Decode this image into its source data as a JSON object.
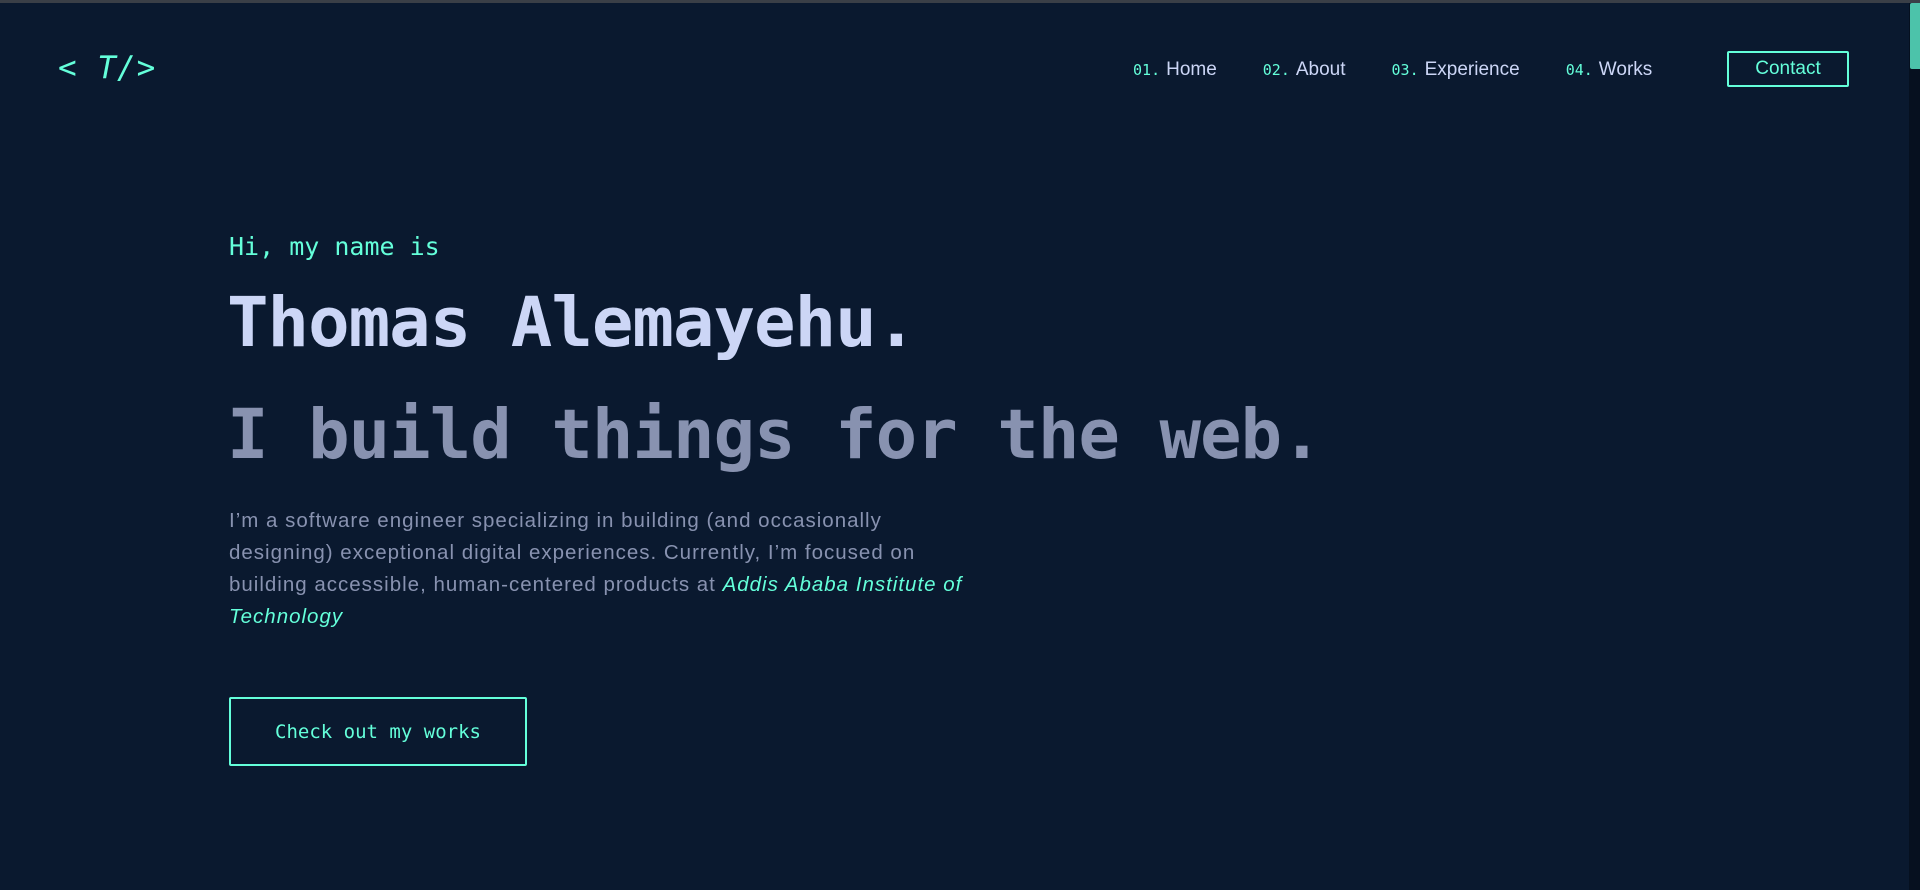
{
  "logo": {
    "text": "< T/>"
  },
  "nav": {
    "items": [
      {
        "num": "01",
        "label": "Home"
      },
      {
        "num": "02",
        "label": "About"
      },
      {
        "num": "03",
        "label": "Experience"
      },
      {
        "num": "04",
        "label": "Works"
      }
    ],
    "contact_label": "Contact"
  },
  "hero": {
    "greeting": "Hi, my name is",
    "name": "Thomas Alemayehu.",
    "tagline": "I build things for the web.",
    "bio_text": "I’m a software engineer specializing in building (and occasionally designing) exceptional digital experiences. Currently, I’m focused on building accessible, human-centered products at ",
    "bio_highlight": "Addis Ababa Institute of Technology",
    "cta_label": "Check out my works"
  },
  "colors": {
    "background": "#0a192f",
    "accent": "#64ffda",
    "heading": "#ccd6f6",
    "muted": "#8892b0"
  }
}
